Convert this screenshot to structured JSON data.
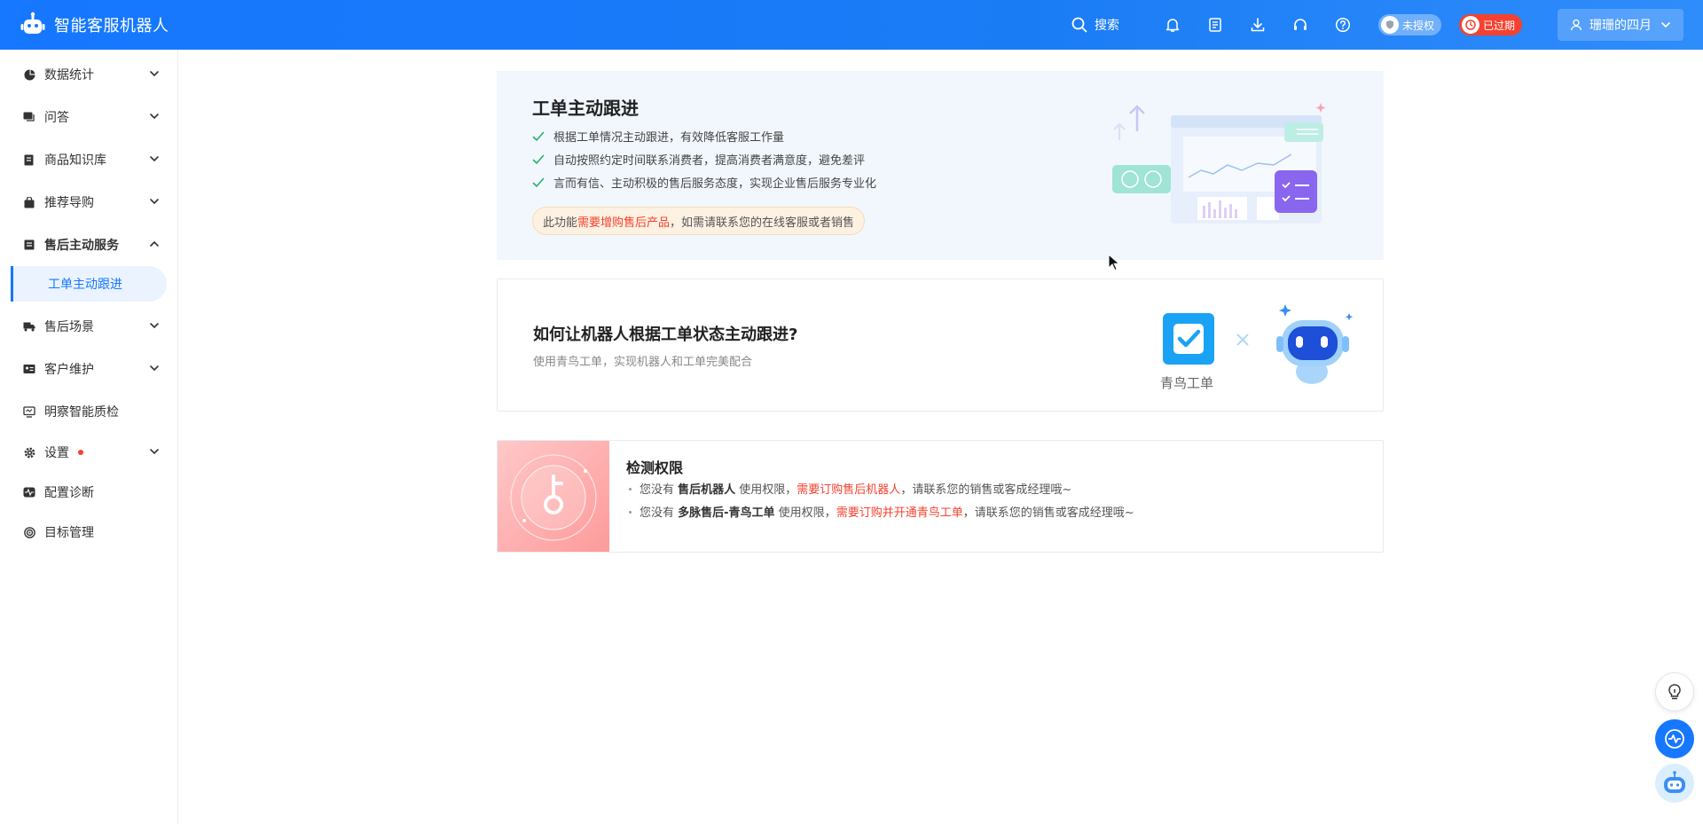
{
  "app": {
    "title": "智能客服机器人"
  },
  "header": {
    "search_label": "搜索",
    "icons": [
      "bell-icon",
      "report-icon",
      "download-icon",
      "headset-icon",
      "help-icon"
    ],
    "badge_unauthorized": "未授权",
    "badge_expired": "已过期",
    "user_name": "珊珊的四月"
  },
  "sidebar": {
    "items": [
      {
        "label": "数据统计",
        "icon": "pie-chart-icon"
      },
      {
        "label": "问答",
        "icon": "chat-icon"
      },
      {
        "label": "商品知识库",
        "icon": "book-icon"
      },
      {
        "label": "推荐导购",
        "icon": "bag-icon"
      },
      {
        "label": "售后主动服务",
        "icon": "list-icon"
      },
      {
        "label": "工单主动跟进"
      },
      {
        "label": "售后场景",
        "icon": "truck-icon"
      },
      {
        "label": "客户维护",
        "icon": "id-card-icon"
      },
      {
        "label": "明察智能质检",
        "icon": "monitor-icon"
      },
      {
        "label": "设置",
        "icon": "gear-icon"
      },
      {
        "label": "配置诊断",
        "icon": "pulse-icon"
      },
      {
        "label": "目标管理",
        "icon": "target-icon"
      }
    ]
  },
  "intro_card": {
    "title": "工单主动跟进",
    "features": [
      "根据工单情况主动跟进，有效降低客服工作量",
      "自动按照约定时间联系消费者，提高消费者满意度，避免差评",
      "言而有信、主动积极的售后服务态度，实现企业售后服务专业化"
    ],
    "notice_prefix": "此功能",
    "notice_highlight": "需要增购售后产品",
    "notice_suffix": "，如需请联系您的在线客服或者销售"
  },
  "howto_card": {
    "title": "如何让机器人根据工单状态主动跟进?",
    "subtitle": "使用青鸟工单，实现机器人和工单完美配合",
    "logo_label": "青鸟工单"
  },
  "permission_card": {
    "title": "检测权限",
    "lines": [
      {
        "prefix": "您没有 ",
        "product": "售后机器人",
        "middle": " 使用权限，",
        "highlight": "需要订购售后机器人",
        "suffix": "，请联系您的销售或客成经理哦~"
      },
      {
        "prefix": "您没有 ",
        "product": "多脉售后-青鸟工单",
        "middle": " 使用权限，",
        "highlight": "需要订购并开通青鸟工单",
        "suffix": "，请联系您的销售或客成经理哦~"
      }
    ]
  },
  "colors": {
    "primary": "#1677ff",
    "danger": "#f5412f",
    "card_bg": "#f2f7fd",
    "success": "#21b36a"
  }
}
